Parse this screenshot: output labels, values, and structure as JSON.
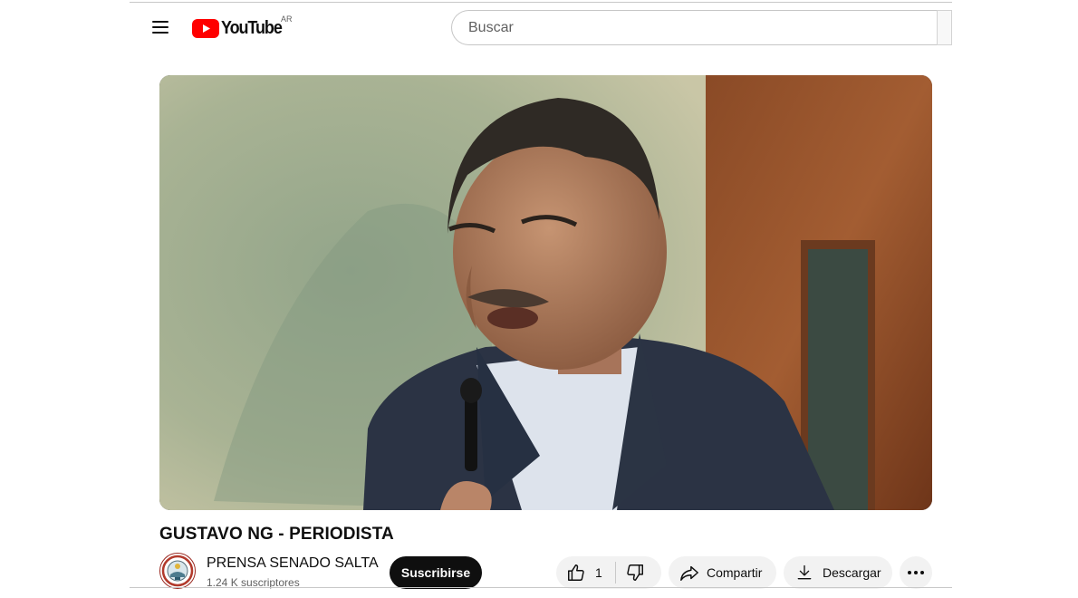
{
  "header": {
    "logo_text": "YouTube",
    "country_code": "AR",
    "search_placeholder": "Buscar"
  },
  "video": {
    "title": "GUSTAVO NG - PERIODISTA"
  },
  "channel": {
    "name": "PRENSA SENADO SALTA",
    "subscribers": "1.24 K suscriptores",
    "subscribe_label": "Suscribirse"
  },
  "actions": {
    "like_count": "1",
    "share_label": "Compartir",
    "download_label": "Descargar"
  },
  "icons": [
    "menu-icon",
    "youtube-logo-icon",
    "thumbs-up-icon",
    "thumbs-down-icon",
    "share-icon",
    "download-icon",
    "more-icon"
  ],
  "colors": {
    "brand_red": "#ff0000",
    "subscribe_bg": "#0f0f0f",
    "pill_bg": "#f2f2f2"
  }
}
